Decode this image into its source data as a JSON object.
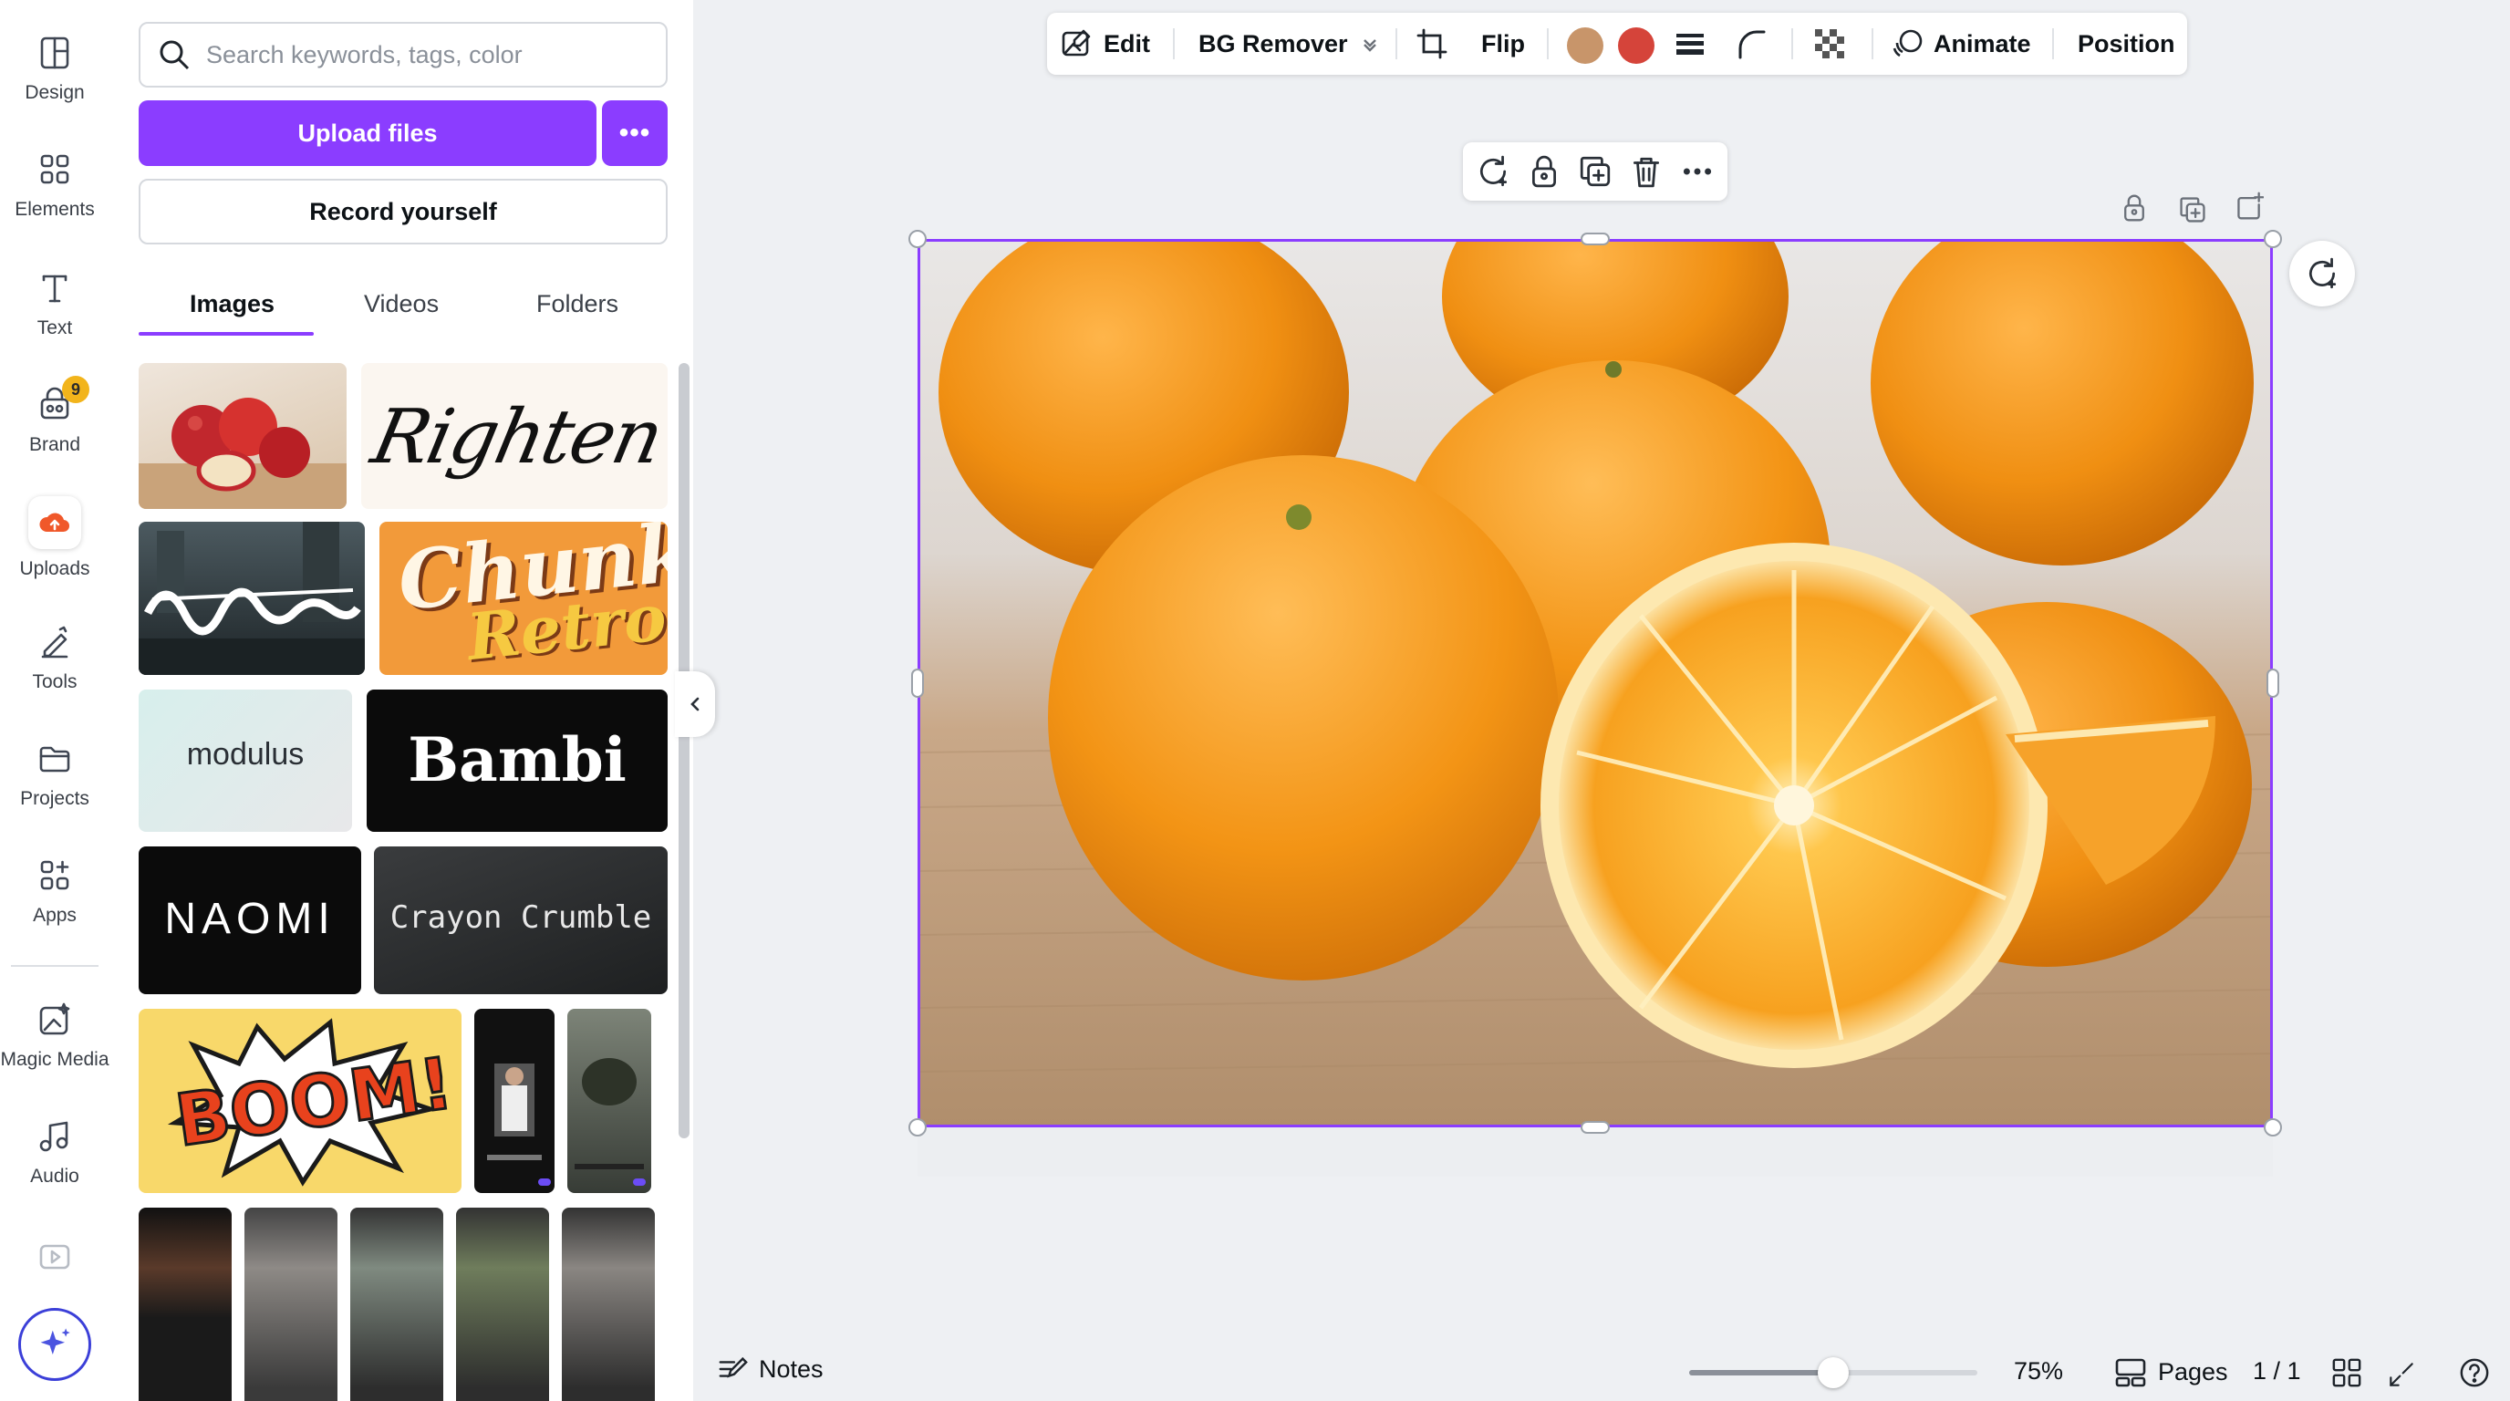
{
  "rail": {
    "items": [
      {
        "label": "Design",
        "icon": "design-icon"
      },
      {
        "label": "Elements",
        "icon": "elements-icon"
      },
      {
        "label": "Text",
        "icon": "text-icon"
      },
      {
        "label": "Brand",
        "icon": "brand-icon",
        "badge": "9"
      },
      {
        "label": "Uploads",
        "icon": "uploads-icon"
      },
      {
        "label": "Tools",
        "icon": "tools-icon"
      },
      {
        "label": "Projects",
        "icon": "projects-icon"
      },
      {
        "label": "Apps",
        "icon": "apps-icon"
      },
      {
        "label": "Magic Media",
        "icon": "magic-media-icon"
      },
      {
        "label": "Audio",
        "icon": "audio-icon"
      }
    ]
  },
  "panel": {
    "search_placeholder": "Search keywords, tags, color",
    "upload_label": "Upload files",
    "more_label": "•••",
    "record_label": "Record yourself",
    "tabs": [
      {
        "label": "Images",
        "active": true
      },
      {
        "label": "Videos",
        "active": false
      },
      {
        "label": "Folders",
        "active": false
      }
    ],
    "thumbs": {
      "font_righten": "Righten",
      "font_chunky": "Chunky",
      "font_retro": "Retro",
      "font_modulus": "modulus",
      "font_bambi": "Bambi",
      "font_naomi": "NAOMI",
      "font_crayon": "Crayon Crumble",
      "boom": "BOOM!"
    }
  },
  "toolbar": {
    "edit": "Edit",
    "bg_remover": "BG Remover",
    "flip": "Flip",
    "animate": "Animate",
    "position": "Position",
    "swatch_colors": [
      "#c8956a",
      "#d5443a"
    ]
  },
  "footer": {
    "notes": "Notes",
    "zoom": "75%",
    "zoom_level": 0.5,
    "pages": "Pages",
    "page_count": "1 / 1"
  },
  "colors": {
    "accent": "#8b3dff",
    "badge": "#f2b41b",
    "uploads_cloud": "#f0582a"
  }
}
